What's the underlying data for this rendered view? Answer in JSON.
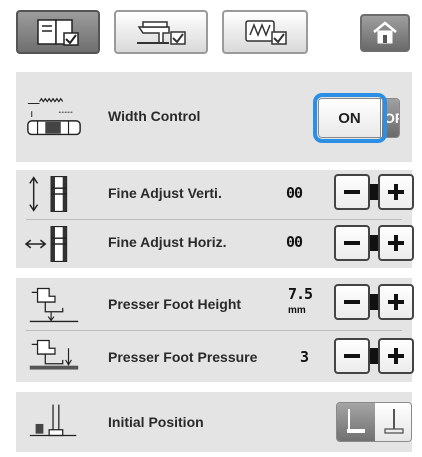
{
  "tabs": [
    {
      "icon": "settings-page-icon",
      "active": true
    },
    {
      "icon": "sewing-machine-settings-icon",
      "active": false
    },
    {
      "icon": "embroidery-settings-icon",
      "active": false
    }
  ],
  "home_icon": "home-icon",
  "width_control": {
    "label": "Width Control",
    "on_label": "ON",
    "off_label": "OFF",
    "state": "ON"
  },
  "fine_adjust_verti": {
    "label": "Fine Adjust Verti.",
    "value": "00"
  },
  "fine_adjust_horiz": {
    "label": "Fine Adjust Horiz.",
    "value": "00"
  },
  "presser_foot_height": {
    "label": "Presser Foot Height",
    "value": "7.5",
    "unit": "mm"
  },
  "presser_foot_pressure": {
    "label": "Presser Foot Pressure",
    "value": "3"
  },
  "initial_position": {
    "label": "Initial Position"
  },
  "colors": {
    "panel": "#e4e4e4",
    "focus": "#2b8fe6",
    "active_tab": "#7a7a7a"
  }
}
